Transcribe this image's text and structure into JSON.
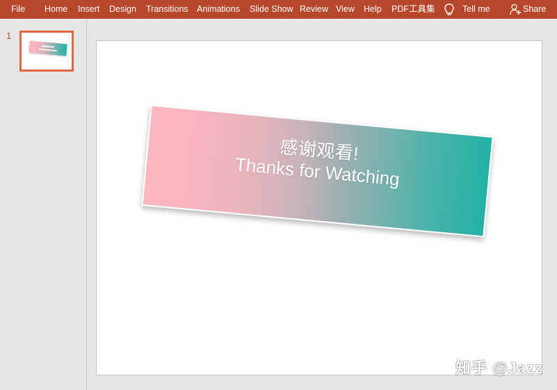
{
  "ribbon": {
    "accent_color": "#b7472a",
    "tabs": [
      "File",
      "Home",
      "Insert",
      "Design",
      "Transitions",
      "Animations",
      "Slide Show",
      "Review",
      "View",
      "Help",
      "PDF工具集"
    ],
    "tell_me": "Tell me",
    "tell_me_icon": "lightbulb-icon",
    "share": "Share",
    "share_icon": "person-icon"
  },
  "thumbnails": {
    "slide_number": "1"
  },
  "slide": {
    "title_cn": "感谢观看!",
    "title_en": "Thanks for Watching",
    "gradient_colors": [
      "#fcb8c1",
      "#22b2a5"
    ]
  },
  "watermark": "知乎 @Jazz"
}
